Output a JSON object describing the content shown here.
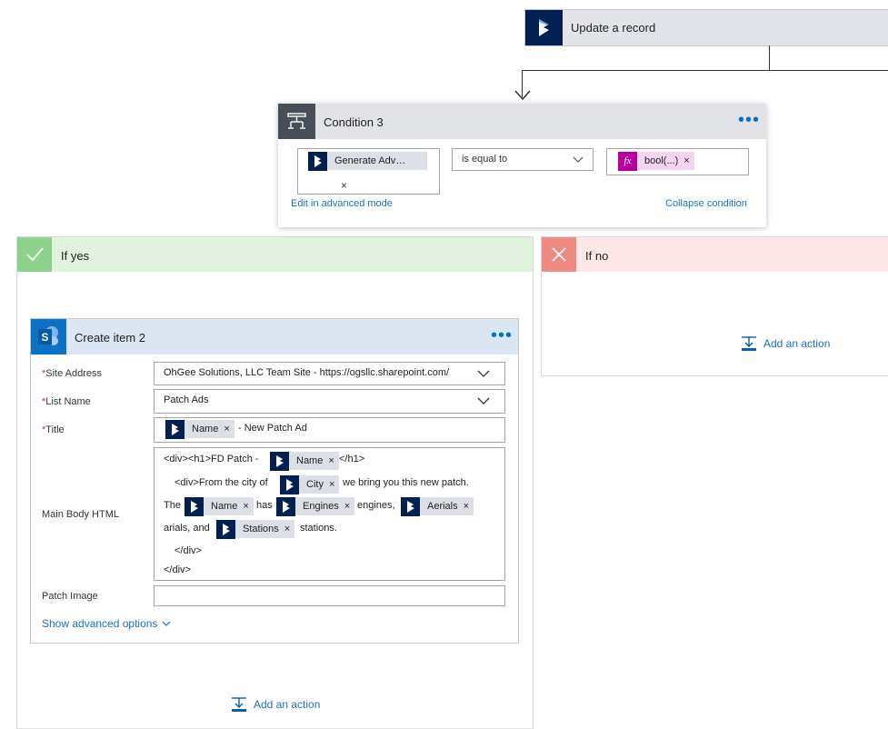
{
  "update_record": {
    "title": "Update a record",
    "icon": "dynamics-icon"
  },
  "condition": {
    "title": "Condition 3",
    "more": "…",
    "left_token": {
      "label": "Generate Adv…",
      "remove": "×"
    },
    "operator": "is equal to",
    "right_token": {
      "label": "bool(...)",
      "remove": "×",
      "icon_text": "fx"
    },
    "edit_advanced": "Edit in advanced mode",
    "collapse": "Collapse condition"
  },
  "if_yes": {
    "title": "If yes",
    "add_action": "Add an action"
  },
  "if_no": {
    "title": "If no",
    "add_action": "Add an action"
  },
  "create_item": {
    "title": "Create item 2",
    "more": "…",
    "required_mark": "*",
    "site_address_label": "Site Address",
    "site_address_value": "OhGee Solutions, LLC Team Site - https://ogsllc.sharepoint.com/",
    "list_name_label": "List Name",
    "list_name_value": "Patch Ads",
    "title_label": "Title",
    "title_token": "Name",
    "title_suffix": "- New Patch Ad",
    "body_label": "Main Body HTML",
    "body": {
      "l1_a": "<div><h1>FD Patch -",
      "l1_token": "Name",
      "l1_b": "</h1>",
      "l2_a": "<div>From the city of",
      "l2_token": "City",
      "l2_b": "we bring you this new patch.",
      "l3_a": "The",
      "l3_token1": "Name",
      "l3_b": "has",
      "l3_token2": "Engines",
      "l3_c": "engines,",
      "l3_token3": "Aerials",
      "l4_a": "arials, and",
      "l4_token": "Stations",
      "l4_b": "stations.",
      "l5": "</div>",
      "l6": "</div>"
    },
    "remove": "×",
    "patch_image_label": "Patch Image",
    "show_advanced": "Show advanced options"
  },
  "colors": {
    "dynamics_blue": "#002050",
    "sharepoint_blue": "#0b72c6",
    "link_blue": "#1a73c0",
    "yes_green": "#8cd28a",
    "no_red": "#f08b84"
  }
}
